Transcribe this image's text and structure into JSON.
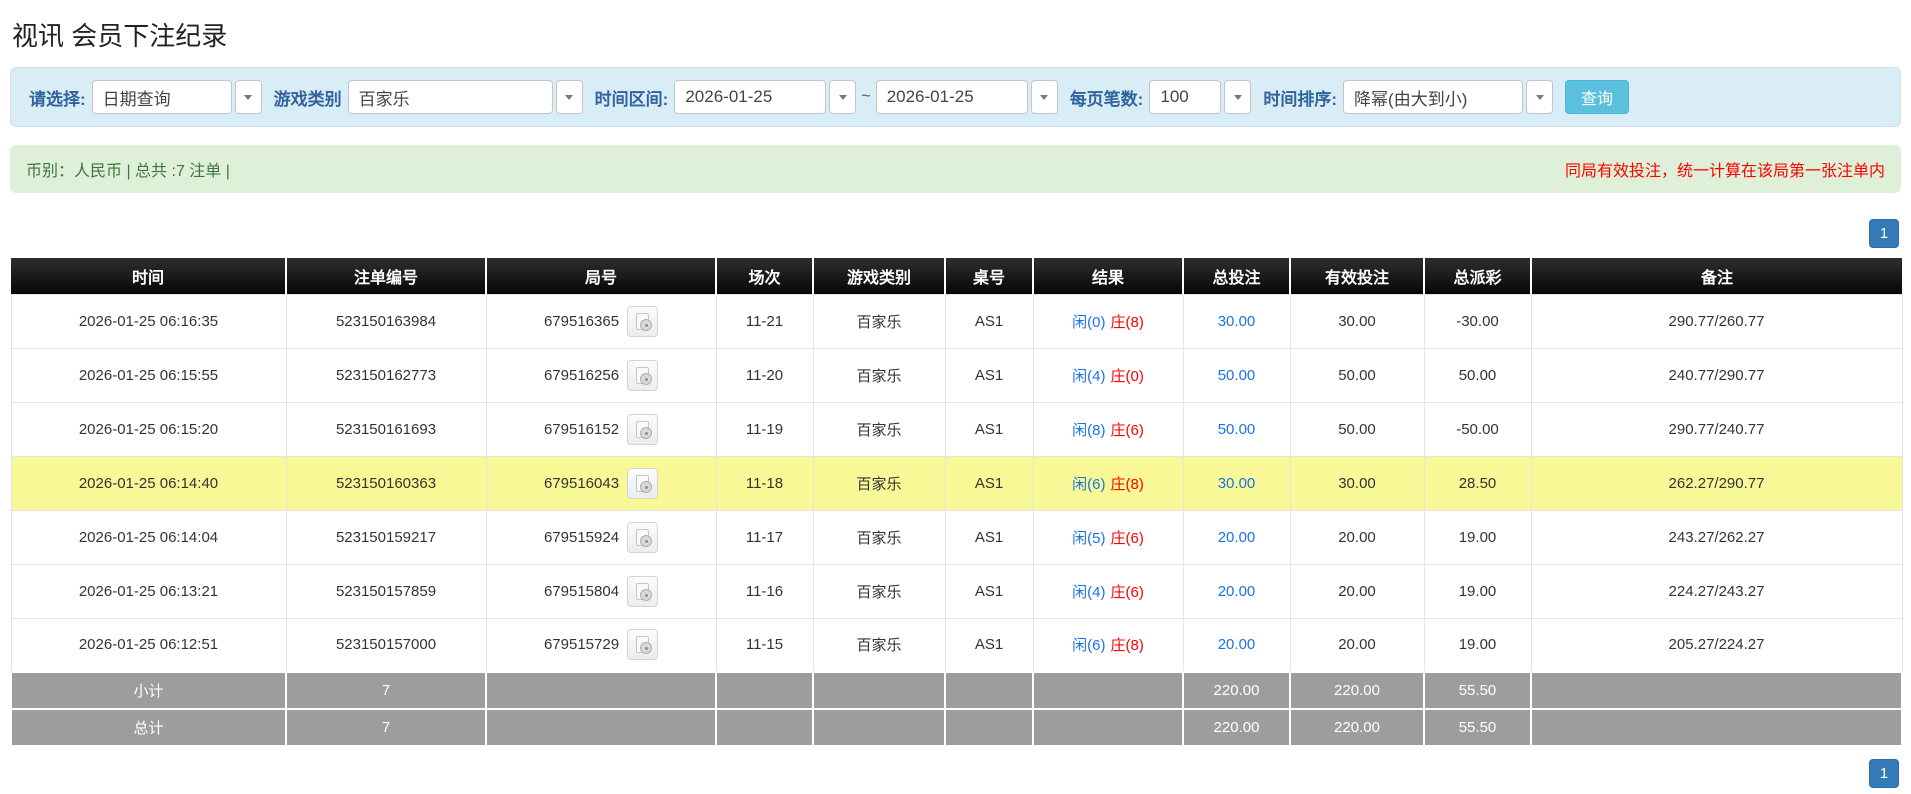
{
  "page": {
    "title": "视讯 会员下注纪录"
  },
  "colors": {
    "accent_blue": "#337ab7",
    "button_cyan": "#5bc0de",
    "link_blue": "#1a73e8",
    "player_blue": "#1a73e8",
    "banker_red": "#ff0000",
    "red": "#ff0000",
    "filter_bg": "#d9edf7",
    "filter_label": "#31639c",
    "summary_bg": "#dff0d8",
    "summary_text": "#3c763d",
    "highlight_yellow": "#f8f896",
    "grey_row_bg": "#9d9d9d"
  },
  "filters": {
    "query_type": {
      "label": "请选择:",
      "value": "日期查询"
    },
    "game_type": {
      "label": "游戏类别",
      "value": "百家乐"
    },
    "time_range": {
      "label": "时间区间:",
      "from": "2026-01-25",
      "separator": "~",
      "to": "2026-01-25"
    },
    "page_size": {
      "label": "每页笔数:",
      "value": "100"
    },
    "time_sort": {
      "label": "时间排序:",
      "value": "降幂(由大到小)"
    },
    "search_button": "查询"
  },
  "summary_bar": {
    "left": "币别：人民币 | 总共 :7 注单 |",
    "right": "同局有效投注，统一计算在该局第一张注单内"
  },
  "pagination": {
    "page": "1"
  },
  "table": {
    "headers": [
      "时间",
      "注单编号",
      "局号",
      "场次",
      "游戏类别",
      "桌号",
      "结果",
      "总投注",
      "有效投注",
      "总派彩",
      "备注"
    ],
    "rows": [
      {
        "time": "2026-01-25 06:16:35",
        "bet_id": "523150163984",
        "round_id": "679516365",
        "session": "11-21",
        "game": "百家乐",
        "table_no": "AS1",
        "result_player": "闲(0)",
        "result_banker": "庄(8)",
        "total_bet": "30.00",
        "valid_bet": "30.00",
        "payout": "-30.00",
        "remark": "290.77/260.77",
        "highlight": false
      },
      {
        "time": "2026-01-25 06:15:55",
        "bet_id": "523150162773",
        "round_id": "679516256",
        "session": "11-20",
        "game": "百家乐",
        "table_no": "AS1",
        "result_player": "闲(4)",
        "result_banker": "庄(0)",
        "total_bet": "50.00",
        "valid_bet": "50.00",
        "payout": "50.00",
        "remark": "240.77/290.77",
        "highlight": false
      },
      {
        "time": "2026-01-25 06:15:20",
        "bet_id": "523150161693",
        "round_id": "679516152",
        "session": "11-19",
        "game": "百家乐",
        "table_no": "AS1",
        "result_player": "闲(8)",
        "result_banker": "庄(6)",
        "total_bet": "50.00",
        "valid_bet": "50.00",
        "payout": "-50.00",
        "remark": "290.77/240.77",
        "highlight": false
      },
      {
        "time": "2026-01-25 06:14:40",
        "bet_id": "523150160363",
        "round_id": "679516043",
        "session": "11-18",
        "game": "百家乐",
        "table_no": "AS1",
        "result_player": "闲(6)",
        "result_banker": "庄(8)",
        "total_bet": "30.00",
        "valid_bet": "30.00",
        "payout": "28.50",
        "remark": "262.27/290.77",
        "highlight": true
      },
      {
        "time": "2026-01-25 06:14:04",
        "bet_id": "523150159217",
        "round_id": "679515924",
        "session": "11-17",
        "game": "百家乐",
        "table_no": "AS1",
        "result_player": "闲(5)",
        "result_banker": "庄(6)",
        "total_bet": "20.00",
        "valid_bet": "20.00",
        "payout": "19.00",
        "remark": "243.27/262.27",
        "highlight": false
      },
      {
        "time": "2026-01-25 06:13:21",
        "bet_id": "523150157859",
        "round_id": "679515804",
        "session": "11-16",
        "game": "百家乐",
        "table_no": "AS1",
        "result_player": "闲(4)",
        "result_banker": "庄(6)",
        "total_bet": "20.00",
        "valid_bet": "20.00",
        "payout": "19.00",
        "remark": "224.27/243.27",
        "highlight": false
      },
      {
        "time": "2026-01-25 06:12:51",
        "bet_id": "523150157000",
        "round_id": "679515729",
        "session": "11-15",
        "game": "百家乐",
        "table_no": "AS1",
        "result_player": "闲(6)",
        "result_banker": "庄(8)",
        "total_bet": "20.00",
        "valid_bet": "20.00",
        "payout": "19.00",
        "remark": "205.27/224.27",
        "highlight": false
      }
    ],
    "subtotal": {
      "label": "小计",
      "count": "7",
      "total_bet": "220.00",
      "valid_bet": "220.00",
      "payout": "55.50"
    },
    "total": {
      "label": "总计",
      "count": "7",
      "total_bet": "220.00",
      "valid_bet": "220.00",
      "payout": "55.50"
    }
  }
}
